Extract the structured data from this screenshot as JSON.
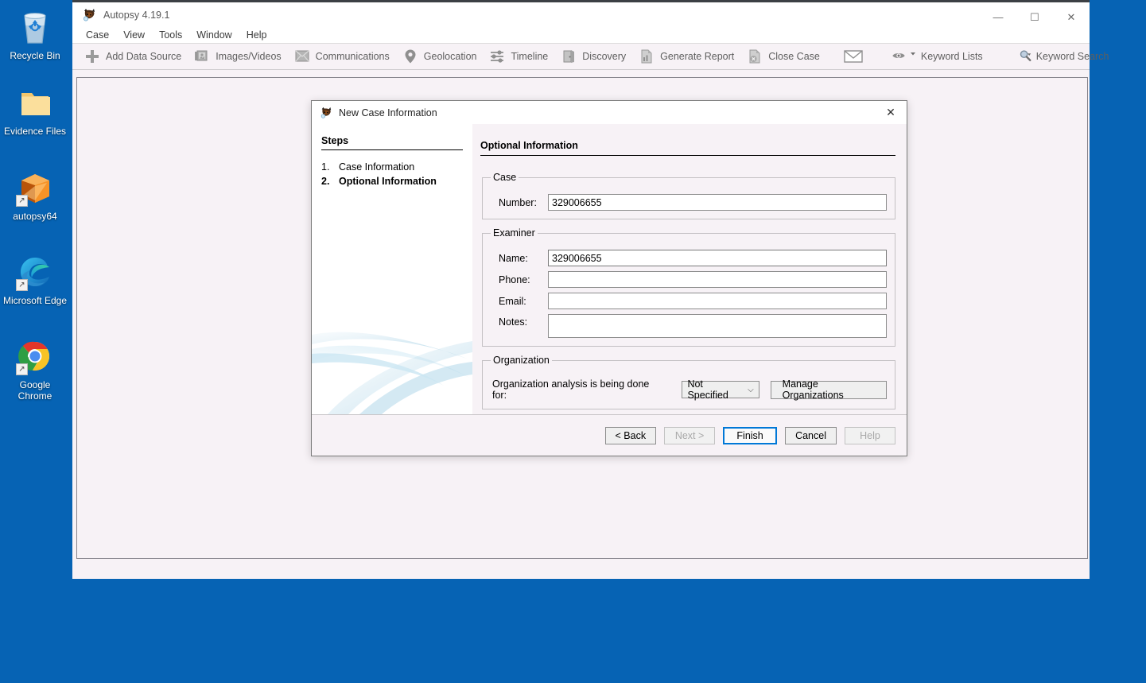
{
  "desktop": {
    "background_color": "#0663b4",
    "icons": [
      {
        "label": "Recycle Bin",
        "icon": "recycle-bin-icon",
        "shortcut": false
      },
      {
        "label": "Evidence Files",
        "icon": "folder-icon",
        "shortcut": false
      },
      {
        "label": "autopsy64",
        "icon": "autopsy-cube-icon",
        "shortcut": true
      },
      {
        "label": "Microsoft Edge",
        "icon": "microsoft-edge-icon",
        "shortcut": true
      },
      {
        "label": "Google Chrome",
        "icon": "google-chrome-icon",
        "shortcut": true
      }
    ]
  },
  "window": {
    "title": "Autopsy 4.19.1",
    "title_icon": "autopsy-logo-icon",
    "controls": {
      "minimize": "—",
      "maximize": "☐",
      "close": "✕"
    },
    "menu": [
      "Case",
      "View",
      "Tools",
      "Window",
      "Help"
    ],
    "toolbar": {
      "items": [
        {
          "label": "Add Data Source",
          "icon": "plus-icon"
        },
        {
          "label": "Images/Videos",
          "icon": "images-videos-icon"
        },
        {
          "label": "Communications",
          "icon": "communications-icon"
        },
        {
          "label": "Geolocation",
          "icon": "map-pin-icon"
        },
        {
          "label": "Timeline",
          "icon": "timeline-icon"
        },
        {
          "label": "Discovery",
          "icon": "discovery-icon"
        },
        {
          "label": "Generate Report",
          "icon": "report-icon"
        },
        {
          "label": "Close Case",
          "icon": "close-case-icon"
        }
      ],
      "mail": {
        "label": "",
        "icon": "envelope-icon"
      },
      "keyword_lists": {
        "label": "Keyword Lists",
        "icon": "eye-icon"
      },
      "keyword_search": {
        "label": "Keyword Search",
        "icon": "magnifier-icon"
      }
    }
  },
  "dialog": {
    "title": "New Case Information",
    "title_icon": "autopsy-logo-icon",
    "close_label": "✕",
    "steps_header": "Steps",
    "steps": [
      {
        "num": "1.",
        "label": "Case Information",
        "active": false
      },
      {
        "num": "2.",
        "label": "Optional Information",
        "active": true
      }
    ],
    "pane_title": "Optional Information",
    "case_group": {
      "legend": "Case",
      "number_label": "Number:",
      "number_value": "329006655"
    },
    "examiner_group": {
      "legend": "Examiner",
      "name_label": "Name:",
      "name_value": "329006655",
      "phone_label": "Phone:",
      "phone_value": "",
      "email_label": "Email:",
      "email_value": "",
      "notes_label": "Notes:",
      "notes_value": ""
    },
    "organization_group": {
      "legend": "Organization",
      "prompt": "Organization analysis is being done for:",
      "select_value": "Not Specified",
      "select_options": [
        "Not Specified"
      ],
      "manage_button": "Manage Organizations"
    },
    "footer": {
      "back": "< Back",
      "next": "Next >",
      "finish": "Finish",
      "cancel": "Cancel",
      "help": "Help"
    }
  },
  "colors": {
    "desktop_blue": "#0663b4",
    "app_background": "#f7f2f6",
    "accent_focus": "#0078d7",
    "title_text": "#5a5a5a"
  }
}
